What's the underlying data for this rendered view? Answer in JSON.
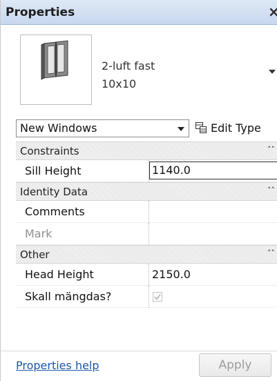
{
  "panel": {
    "title": "Properties",
    "close_glyph": "×"
  },
  "type_selector": {
    "family_name": "2-luft fast",
    "type_name": "10x10",
    "thumbnail_icon": "window-icon"
  },
  "instance_filter": {
    "selected": "New Windows",
    "edit_type_label": "Edit Type",
    "edit_type_icon": "edit-type-icon"
  },
  "groups": [
    {
      "label": "Constraints",
      "collapse_glyph": "˄˄",
      "rows": [
        {
          "name": "Sill Height",
          "value": "1140.0",
          "editing": true
        }
      ]
    },
    {
      "label": "Identity Data",
      "collapse_glyph": "˄˄",
      "rows": [
        {
          "name": "Comments",
          "value": ""
        },
        {
          "name": "Mark",
          "value": "",
          "disabled": true
        }
      ]
    },
    {
      "label": "Other",
      "collapse_glyph": "˄˄",
      "rows": [
        {
          "name": "Head Height",
          "value": "2150.0"
        },
        {
          "name": "Skall mängdas?",
          "checkbox": true,
          "checked": true
        }
      ]
    }
  ],
  "footer": {
    "help_link": "Properties help",
    "apply_label": "Apply"
  },
  "colors": {
    "link": "#1a57a8",
    "title_bar": "#c7d8ee",
    "disabled_text": "#8f8f8f"
  }
}
